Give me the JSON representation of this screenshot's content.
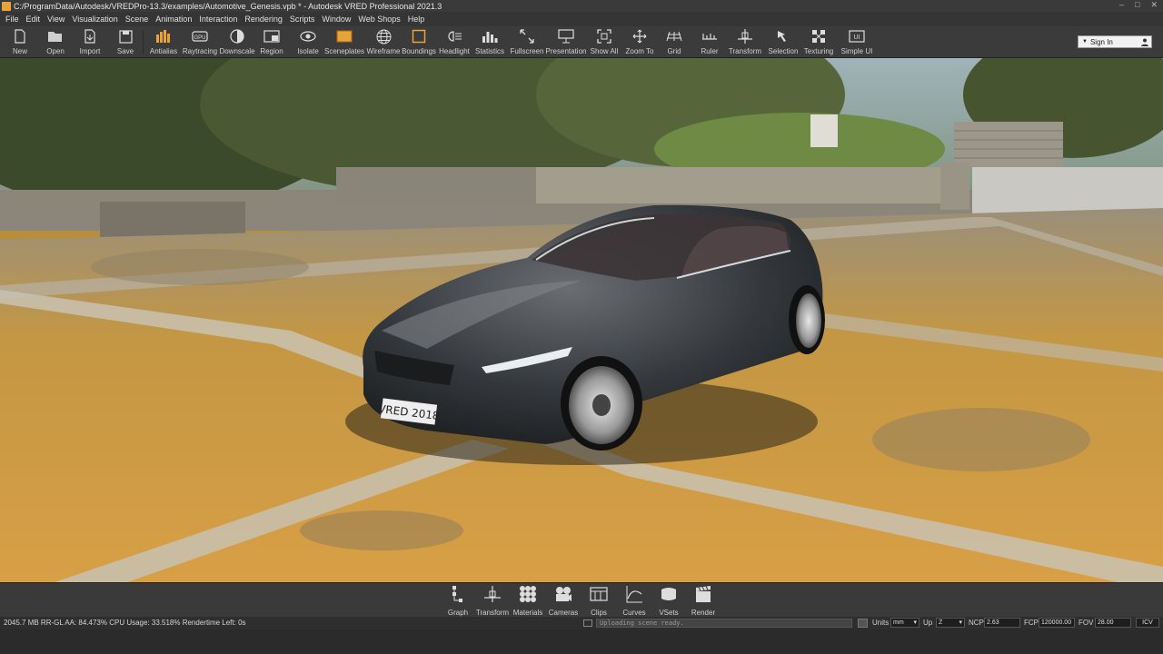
{
  "window": {
    "title": "C:/ProgramData/Autodesk/VREDPro-13.3/examples/Automotive_Genesis.vpb * - Autodesk VRED Professional 2021.3",
    "controls": [
      "–",
      "□",
      "✕"
    ]
  },
  "menu": [
    "File",
    "Edit",
    "View",
    "Visualization",
    "Scene",
    "Animation",
    "Interaction",
    "Rendering",
    "Scripts",
    "Window",
    "Web Shops",
    "Help"
  ],
  "toolbar": {
    "items": [
      {
        "label": "New",
        "icon": "new-file-icon"
      },
      {
        "label": "Open",
        "icon": "folder-open-icon"
      },
      {
        "label": "Import",
        "icon": "import-icon"
      },
      {
        "label": "Save",
        "icon": "save-icon"
      },
      {
        "label": "Antialias",
        "icon": "antialias-icon"
      },
      {
        "label": "Raytracing",
        "icon": "raytracing-icon"
      },
      {
        "label": "Downscale",
        "icon": "downscale-icon"
      },
      {
        "label": "Region",
        "icon": "region-icon"
      },
      {
        "label": "Isolate",
        "icon": "isolate-icon"
      },
      {
        "label": "Sceneplates",
        "icon": "sceneplates-icon"
      },
      {
        "label": "Wireframe",
        "icon": "wireframe-icon"
      },
      {
        "label": "Boundings",
        "icon": "boundings-icon"
      },
      {
        "label": "Headlight",
        "icon": "headlight-icon"
      },
      {
        "label": "Statistics",
        "icon": "statistics-icon"
      },
      {
        "label": "Fullscreen",
        "icon": "fullscreen-icon"
      },
      {
        "label": "Presentation",
        "icon": "presentation-icon"
      },
      {
        "label": "Show All",
        "icon": "show-all-icon"
      },
      {
        "label": "Zoom To",
        "icon": "zoom-to-icon"
      },
      {
        "label": "Grid",
        "icon": "grid-icon"
      },
      {
        "label": "Ruler",
        "icon": "ruler-icon"
      },
      {
        "label": "Transform",
        "icon": "transform-icon"
      },
      {
        "label": "Selection",
        "icon": "selection-icon"
      },
      {
        "label": "Texturing",
        "icon": "texturing-icon"
      },
      {
        "label": "Simple UI",
        "icon": "simple-ui-icon"
      }
    ],
    "signin_label": "Sign In"
  },
  "viewport": {
    "license_plate": "VRED 2018"
  },
  "modules": [
    {
      "label": "Graph",
      "icon": "graph-icon"
    },
    {
      "label": "Transform",
      "icon": "transform-module-icon"
    },
    {
      "label": "Materials",
      "icon": "materials-icon"
    },
    {
      "label": "Cameras",
      "icon": "cameras-icon"
    },
    {
      "label": "Clips",
      "icon": "clips-icon"
    },
    {
      "label": "Curves",
      "icon": "curves-icon"
    },
    {
      "label": "VSets",
      "icon": "vsets-icon"
    },
    {
      "label": "Render",
      "icon": "render-icon"
    }
  ],
  "status": {
    "info": "2045.7 MB  RR-GL AA: 84.473% CPU Usage: 33.518% Rendertime Left: 0s",
    "progress_text": "Uploading scene ready.",
    "units_label": "Units",
    "units_value": "mm",
    "up_label": "Up",
    "up_value": "Z",
    "ncp_label": "NCP",
    "ncp_value": "2.63",
    "fcp_label": "FCP",
    "fcp_value": "120000.00",
    "fov_label": "FOV",
    "fov_value": "28.00",
    "icv_label": "ICV"
  },
  "colors": {
    "accent": "#e8a33a",
    "chrome_bg": "#3b3b3b"
  }
}
